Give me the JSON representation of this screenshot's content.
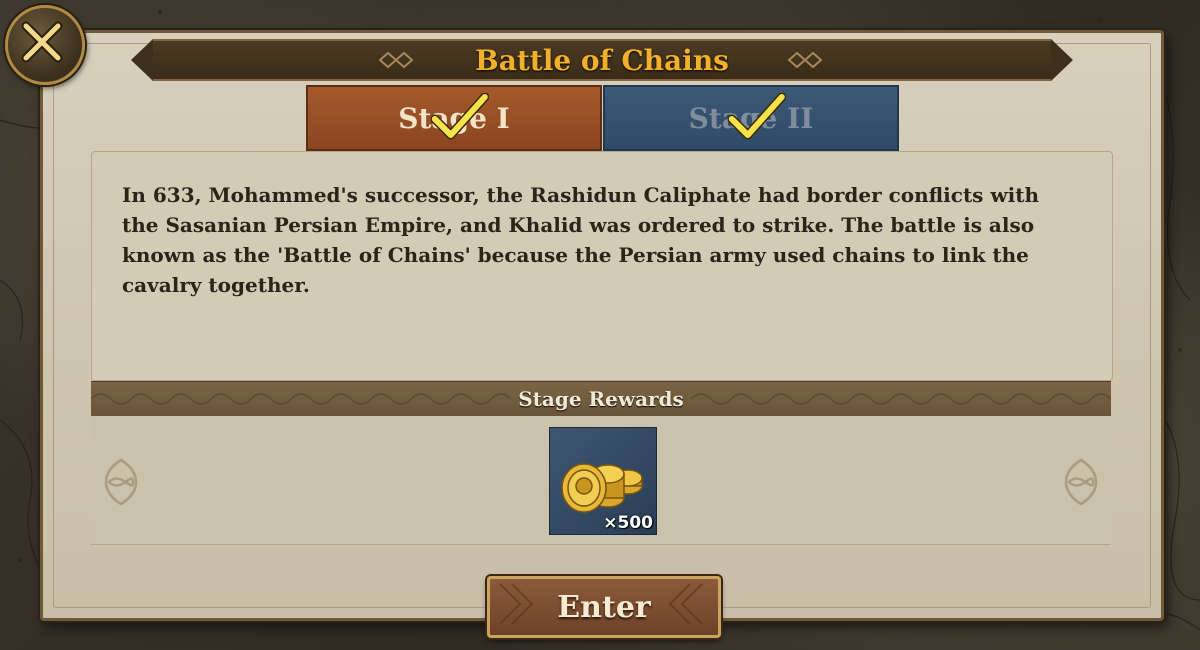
{
  "dialog": {
    "title": "Battle of Chains"
  },
  "tabs": [
    {
      "label": "Stage I",
      "completed": true,
      "active": true,
      "color": "#9c5128"
    },
    {
      "label": "Stage II",
      "completed": true,
      "active": false,
      "color": "#36506f"
    }
  ],
  "description": "In 633, Mohammed's successor, the Rashidun Caliphate had border conflicts with the Sasanian Persian Empire, and Khalid was ordered to strike. The battle is also known as the 'Battle of Chains' because the Persian army used chains to link the cavalry together.",
  "rewards": {
    "header": "Stage Rewards",
    "items": [
      {
        "icon": "gold-coins-icon",
        "quantity": "×500"
      }
    ]
  },
  "buttons": {
    "enter_label": "Enter",
    "close_icon": "close-icon"
  },
  "colors": {
    "title_gold": "#f2b02a",
    "parchment": "#d3cbb6",
    "check_yellow": "#f6e24a"
  }
}
